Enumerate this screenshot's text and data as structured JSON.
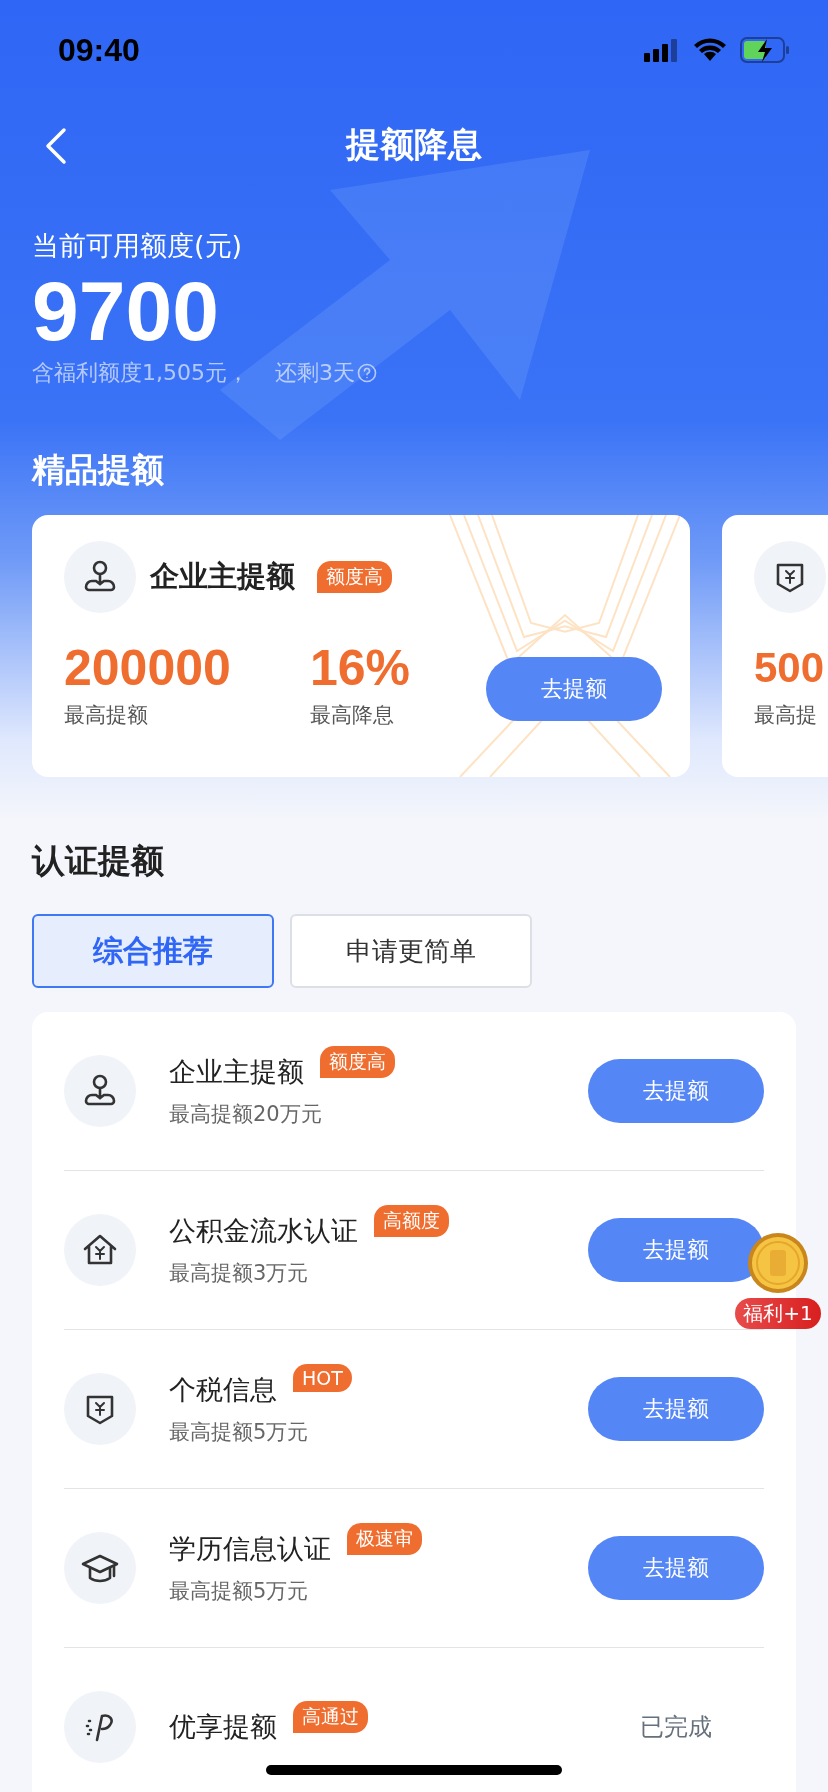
{
  "status_bar": {
    "time": "09:40"
  },
  "nav": {
    "title": "提额降息"
  },
  "credit": {
    "label": "当前可用额度(元)",
    "amount": "9700",
    "note": "含福利额度1,505元，",
    "remaining": "还剩3天"
  },
  "featured": {
    "title": "精品提额",
    "cards": [
      {
        "title": "企业主提额",
        "tag": "额度高",
        "stats": [
          {
            "value": "200000",
            "label": "最高提额"
          },
          {
            "value": "16%",
            "label": "最高降息"
          }
        ],
        "button": "去提额"
      },
      {
        "stats": [
          {
            "value": "500",
            "label": "最高提"
          }
        ]
      }
    ]
  },
  "certify": {
    "title": "认证提额",
    "tabs": [
      {
        "label": "综合推荐",
        "selected": true
      },
      {
        "label": "申请更简单",
        "selected": false
      }
    ],
    "items": [
      {
        "title": "企业主提额",
        "tag": "额度高",
        "subtitle": "最高提额20万元",
        "kind": "button",
        "action": "去提额"
      },
      {
        "title": "公积金流水认证",
        "tag": "高额度",
        "subtitle": "最高提额3万元",
        "kind": "button",
        "action": "去提额"
      },
      {
        "title": "个税信息",
        "tag": "HOT",
        "subtitle": "最高提额5万元",
        "kind": "button",
        "action": "去提额"
      },
      {
        "title": "学历信息认证",
        "tag": "极速审",
        "subtitle": "最高提额5万元",
        "kind": "button",
        "action": "去提额"
      },
      {
        "title": "优享提额",
        "tag": "高通过",
        "kind": "done",
        "action": "已完成"
      }
    ]
  },
  "float_badge": {
    "label": "福利+1"
  }
}
